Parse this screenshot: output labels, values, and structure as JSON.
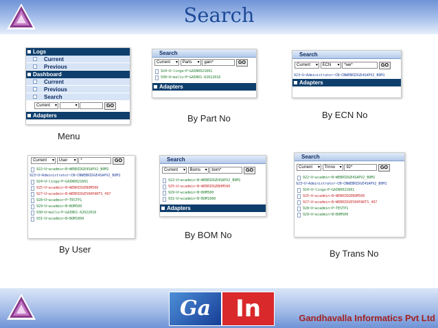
{
  "header": {
    "title": "Search"
  },
  "footer": {
    "brand_ga": "Ga",
    "brand_in": "In",
    "company": "Gandhavalla Informatics Pvt Ltd"
  },
  "common": {
    "current": "Current",
    "go": "GO",
    "search": "Search",
    "adapters": "Adapters"
  },
  "menu": {
    "caption": "Menu",
    "items": [
      {
        "label": "Logs",
        "kind": "group"
      },
      {
        "label": "Current",
        "kind": "item"
      },
      {
        "label": "Previous",
        "kind": "item"
      },
      {
        "label": "Dashboard",
        "kind": "group"
      },
      {
        "label": "Current",
        "kind": "item"
      },
      {
        "label": "Previous",
        "kind": "item"
      },
      {
        "label": "Search",
        "kind": "item"
      }
    ]
  },
  "part": {
    "caption": "By Part No",
    "filter": "Parts",
    "value": "gain*",
    "results": [
      "924~U~linga~P~GAIN0021601",
      "930~U~mallu~P~GAIN01-02022016"
    ]
  },
  "ecn": {
    "caption": "By ECN No",
    "filter": "ECN",
    "value": "*we*",
    "results": [
      "923~U~Administrator~CN~CNWEBRIDGE4SAPV2_BOM1"
    ]
  },
  "user": {
    "caption": "By User",
    "filter": "User",
    "value": "*",
    "results": [
      "922~U~wcadmin~B~WEBRIDGE4SAPV2_BOM1",
      "923~U~Administrator~CN~CNWEBRIDGE4SAPV2_BOM1",
      "924~U~linga~P~GAIN0021601",
      "925~U~wcadmin~B~WEBRIDGEBOM500",
      "927~U~wcadmin~B~WEBRIDGE500PARTS_497",
      "928~U~wcadmin~P~TESTP1",
      "929~U~wcadmin~B~BOM500",
      "930~U~mallu~P~GAIN01-02022016",
      "931~U~wcadmin~B~BOM1000"
    ]
  },
  "bom": {
    "caption": "By BOM No",
    "filter": "Boms",
    "value": "bom*",
    "results": [
      "922~U~wcadmin~B~WEBRIDGE4SAPV2_BOM1",
      "925~U~wcadmin~B~WEBRIDGEBOM500",
      "929~U~wcadmin~B~BOM500",
      "931~U~wcadmin~B~BOM1000"
    ]
  },
  "trans": {
    "caption": "By Trans No",
    "filter": "Trnno",
    "value": "92*",
    "results": [
      "922~U~wcadmin~B~WEBRIDGE4SAPV2_BOM1",
      "923~U~Administrator~CN~CNWEBRIDGE4SAPV2_BOM1",
      "924~U~linga~P~GAIN0021601",
      "925~U~wcadmin~B~WEBRIDGEBOM500",
      "927~U~wcadmin~B~WEBRIDGE500PARTS_497",
      "928~U~wcadmin~P~TESTP1",
      "929~U~wcadmin~B~BOM500"
    ]
  }
}
